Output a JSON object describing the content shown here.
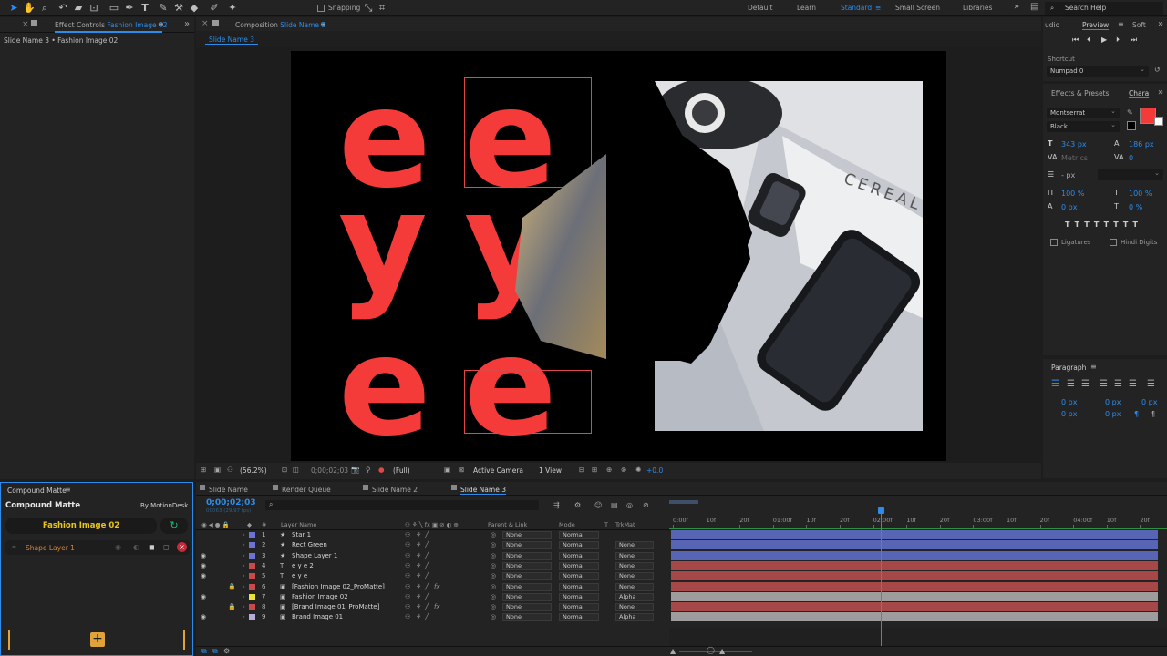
{
  "toolbar": {
    "snapping_label": "Snapping",
    "workspaces": [
      "Default",
      "Learn",
      "Standard",
      "Small Screen",
      "Libraries"
    ],
    "active_workspace": "Standard",
    "search_placeholder": "Search Help"
  },
  "effect_controls": {
    "tab_prefix": "Effect Controls",
    "tab_layer": "Fashion Image 02",
    "breadcrumb": "Slide Name 3 • Fashion Image 02"
  },
  "composition": {
    "tab_prefix": "Composition",
    "tab_comp": "Slide Name 3",
    "subtab": "Slide Name 3",
    "letters": [
      "e",
      "e",
      "y",
      "y",
      "e",
      "e"
    ]
  },
  "comp_footer": {
    "zoom": "(56.2%)",
    "timecode": "0;00;02;03",
    "resolution": "(Full)",
    "camera": "Active Camera",
    "view": "1 View",
    "exposure": "+0.0"
  },
  "right_panels": {
    "audio_tab": "udio",
    "preview_tab": "Preview",
    "soft_tab": "Soft",
    "shortcut_label": "Shortcut",
    "shortcut_value": "Numpad 0",
    "effects_tab": "Effects & Presets",
    "char_tab": "Chara",
    "font_family": "Montserrat",
    "font_style": "Black",
    "font_size": "343 px",
    "leading": "186 px",
    "kerning": "Metrics",
    "tracking": "0",
    "stroke_width": "- px",
    "vscale": "100 %",
    "hscale": "100 %",
    "baseline": "0 px",
    "tsume": "0 %",
    "ligatures": "Ligatures",
    "hindi_digits": "Hindi Digits",
    "paragraph_tab": "Paragraph",
    "indent_values": [
      "0 px",
      "0 px",
      "0 px",
      "0 px",
      "0 px"
    ],
    "fill_color": "#f53a3a"
  },
  "compound_matte": {
    "tab": "Compound Matte",
    "title": "Compound Matte",
    "by": "By MotionDesk",
    "layer_button": "Fashion Image 02",
    "shape_layer": "Shape Layer 1"
  },
  "timeline": {
    "tabs": [
      "Slide Name",
      "Render Queue",
      "Slide Name 2",
      "Slide Name 3"
    ],
    "active_tab": "Slide Name 3",
    "timecode": "0;00;02;03",
    "fps": "00063 (29.97 fps)",
    "col_layer_name": "Layer Name",
    "col_parent": "Parent & Link",
    "col_mode": "Mode",
    "col_trkmat": "TrkMat",
    "col_t": "T",
    "ruler": [
      "0:00f",
      "10f",
      "20f",
      "01:00f",
      "10f",
      "20f",
      "02:00f",
      "10f",
      "20f",
      "03:00f",
      "10f",
      "20f",
      "04:00f",
      "10f",
      "20f"
    ],
    "layers": [
      {
        "num": "1",
        "name": "Star 1",
        "icon": "star",
        "color": "#6b74d6",
        "parent": "None",
        "mode": "Normal",
        "trkmat": "",
        "bar": "#5865b5",
        "eye": false,
        "lock": false,
        "fx": false
      },
      {
        "num": "2",
        "name": "Rect Green",
        "icon": "star",
        "color": "#6b74d6",
        "parent": "None",
        "mode": "Normal",
        "trkmat": "None",
        "bar": "#5865b5",
        "eye": false,
        "lock": false,
        "fx": false
      },
      {
        "num": "3",
        "name": "Shape Layer 1",
        "icon": "star",
        "color": "#6b74d6",
        "parent": "None",
        "mode": "Normal",
        "trkmat": "None",
        "bar": "#5865b5",
        "eye": true,
        "lock": false,
        "fx": false
      },
      {
        "num": "4",
        "name": "e y e 2",
        "icon": "T",
        "color": "#c94a4a",
        "parent": "None",
        "mode": "Normal",
        "trkmat": "None",
        "bar": "#a74848",
        "eye": true,
        "lock": false,
        "fx": false
      },
      {
        "num": "5",
        "name": "e y e",
        "icon": "T",
        "color": "#c94a4a",
        "parent": "None",
        "mode": "Normal",
        "trkmat": "None",
        "bar": "#a74848",
        "eye": true,
        "lock": false,
        "fx": false
      },
      {
        "num": "6",
        "name": "[Fashion Image 02_ProMatte]",
        "icon": "comp",
        "color": "#c94a4a",
        "parent": "None",
        "mode": "Normal",
        "trkmat": "None",
        "bar": "#a74848",
        "eye": false,
        "lock": true,
        "fx": true
      },
      {
        "num": "7",
        "name": "Fashion Image 02",
        "icon": "comp",
        "color": "#e8e23a",
        "parent": "None",
        "mode": "Normal",
        "trkmat": "Alpha",
        "bar": "#9d9d9d",
        "eye": true,
        "lock": false,
        "fx": false
      },
      {
        "num": "8",
        "name": "[Brand Image 01_ProMatte]",
        "icon": "comp",
        "color": "#c94a4a",
        "parent": "None",
        "mode": "Normal",
        "trkmat": "None",
        "bar": "#a74848",
        "eye": false,
        "lock": true,
        "fx": true
      },
      {
        "num": "9",
        "name": "Brand Image 01",
        "icon": "comp",
        "color": "#b7a9d8",
        "parent": "None",
        "mode": "Normal",
        "trkmat": "Alpha",
        "bar": "#9d9d9d",
        "eye": true,
        "lock": false,
        "fx": false
      }
    ]
  },
  "photo_text": "CEREAL"
}
